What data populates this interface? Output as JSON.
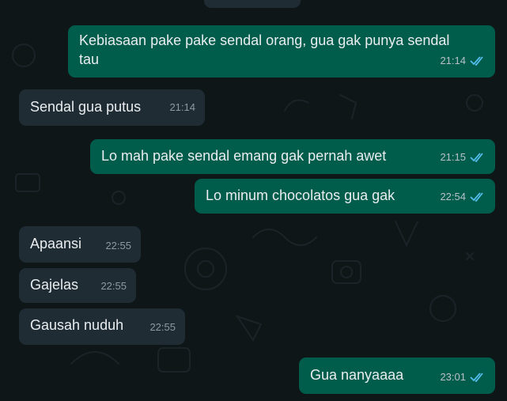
{
  "colors": {
    "background": "#0e1618",
    "incoming_bubble": "#1f2c34",
    "outgoing_bubble": "#005c4b",
    "text": "#e9edef",
    "read_ticks": "#53bdeb"
  },
  "messages": [
    {
      "direction": "outgoing",
      "text": "Kebiasaan pake pake sendal orang, gua gak punya sendal tau",
      "time": "21:14",
      "status": "read-double-check-icon"
    },
    {
      "direction": "incoming",
      "text": "Sendal gua putus",
      "time": "21:14"
    },
    {
      "direction": "outgoing",
      "text": "Lo mah pake sendal emang gak pernah awet",
      "time": "21:15",
      "status": "read-double-check-icon"
    },
    {
      "direction": "outgoing",
      "text": "Lo minum chocolatos gua gak",
      "time": "22:54",
      "status": "read-double-check-icon"
    },
    {
      "direction": "incoming",
      "text": "Apaansi",
      "time": "22:55"
    },
    {
      "direction": "incoming",
      "text": "Gajelas",
      "time": "22:55"
    },
    {
      "direction": "incoming",
      "text": "Gausah nuduh",
      "time": "22:55"
    },
    {
      "direction": "outgoing",
      "text": "Gua nanyaaaa",
      "time": "23:01",
      "status": "read-double-check-icon"
    }
  ]
}
